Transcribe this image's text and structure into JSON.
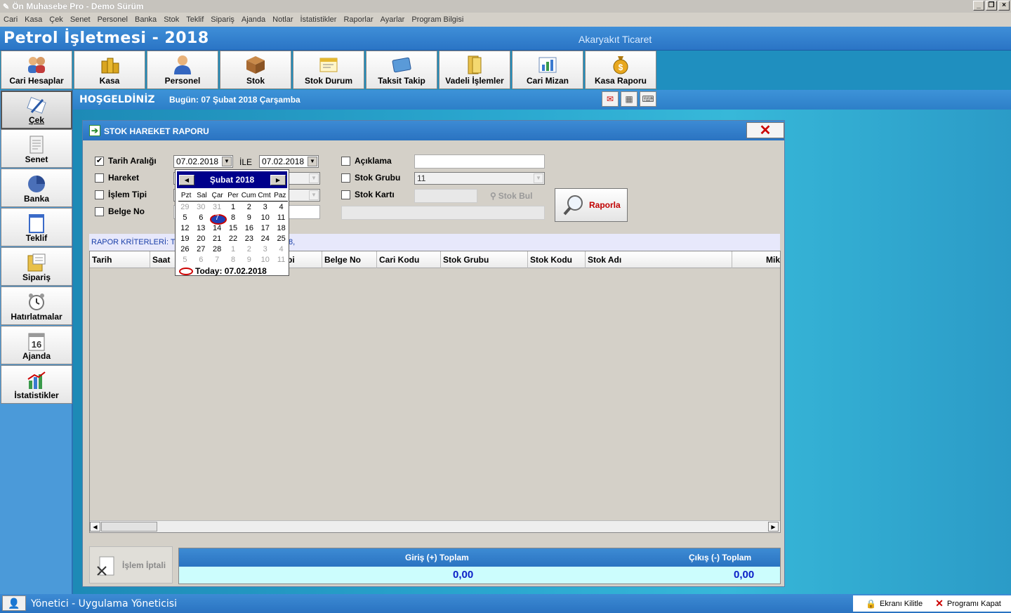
{
  "window": {
    "title": "Ön Muhasebe Pro - Demo Sürüm"
  },
  "menu": [
    "Cari",
    "Kasa",
    "Çek",
    "Senet",
    "Personel",
    "Banka",
    "Stok",
    "Teklif",
    "Sipariş",
    "Ajanda",
    "Notlar",
    "İstatistikler",
    "Raporlar",
    "Ayarlar",
    "Program Bilgisi"
  ],
  "header": {
    "company": "Petrol İşletmesi - 2018",
    "sector": "Akaryakıt Ticaret"
  },
  "toolbar": [
    {
      "label": "Cari Hesaplar",
      "icon": "users-icon"
    },
    {
      "label": "Kasa",
      "icon": "coins-icon"
    },
    {
      "label": "Personel",
      "icon": "person-icon"
    },
    {
      "label": "Stok",
      "icon": "box-icon"
    },
    {
      "label": "Stok Durum",
      "icon": "window-icon"
    },
    {
      "label": "Taksit Takip",
      "icon": "card-icon"
    },
    {
      "label": "Vadeli İşlemler",
      "icon": "folder-icon"
    },
    {
      "label": "Cari Mizan",
      "icon": "chart-icon"
    },
    {
      "label": "Kasa Raporu",
      "icon": "money-bag-icon"
    }
  ],
  "welcome": {
    "greeting": "HOŞGELDİNİZ",
    "today": "Bugün: 07 Şubat 2018 Çarşamba"
  },
  "sidebar": [
    {
      "label": "Çek",
      "icon": "pen-icon",
      "active": true
    },
    {
      "label": "Senet",
      "icon": "document-icon"
    },
    {
      "label": "Banka",
      "icon": "pie-icon"
    },
    {
      "label": "Teklif",
      "icon": "notepad-icon"
    },
    {
      "label": "Sipariş",
      "icon": "order-icon"
    },
    {
      "label": "Hatırlatmalar",
      "icon": "alarm-clock-icon"
    },
    {
      "label": "Ajanda",
      "icon": "calendar-icon"
    },
    {
      "label": "İstatistikler",
      "icon": "stats-icon"
    }
  ],
  "dialog": {
    "title": "STOK HAREKET RAPORU",
    "filters": {
      "tarih_araligi": {
        "label": "Tarih Aralığı",
        "checked": true,
        "from": "07.02.2018",
        "to": "07.02.2018",
        "sep": "İLE"
      },
      "hareket": {
        "label": "Hareket",
        "checked": false
      },
      "islem_tipi": {
        "label": "İşlem Tipi",
        "checked": false
      },
      "belge_no": {
        "label": "Belge No",
        "checked": false
      },
      "aciklama": {
        "label": "Açıklama",
        "checked": false
      },
      "stok_grubu": {
        "label": "Stok Grubu",
        "checked": false,
        "value": "11"
      },
      "stok_karti": {
        "label": "Stok Kartı",
        "checked": false
      },
      "stok_bul": "Stok Bul"
    },
    "rapor_button": "Raporla",
    "criteria_left": "RAPOR KRİTERLERİ:  T",
    "criteria_right": "8,",
    "columns": [
      "Tarih",
      "Saat",
      "pi",
      "Belge No",
      "Cari Kodu",
      "Stok Grubu",
      "Stok Kodu",
      "Stok Adı",
      "Mik"
    ],
    "iptal_button": "İşlem İptali",
    "totals": {
      "giris_label": "Giriş (+) Toplam",
      "cikis_label": "Çıkış (-) Toplam",
      "giris_value": "0,00",
      "cikis_value": "0,00"
    }
  },
  "calendar": {
    "title": "Şubat 2018",
    "dow": [
      "Pzt",
      "Sal",
      "Çar",
      "Per",
      "Cum",
      "Cmt",
      "Paz"
    ],
    "weeks": [
      [
        {
          "d": "29",
          "o": true
        },
        {
          "d": "30",
          "o": true
        },
        {
          "d": "31",
          "o": true
        },
        {
          "d": "1"
        },
        {
          "d": "2"
        },
        {
          "d": "3"
        },
        {
          "d": "4"
        }
      ],
      [
        {
          "d": "5"
        },
        {
          "d": "6"
        },
        {
          "d": "7",
          "t": true
        },
        {
          "d": "8"
        },
        {
          "d": "9"
        },
        {
          "d": "10"
        },
        {
          "d": "11"
        }
      ],
      [
        {
          "d": "12"
        },
        {
          "d": "13"
        },
        {
          "d": "14"
        },
        {
          "d": "15"
        },
        {
          "d": "16"
        },
        {
          "d": "17"
        },
        {
          "d": "18"
        }
      ],
      [
        {
          "d": "19"
        },
        {
          "d": "20"
        },
        {
          "d": "21"
        },
        {
          "d": "22"
        },
        {
          "d": "23"
        },
        {
          "d": "24"
        },
        {
          "d": "25"
        }
      ],
      [
        {
          "d": "26"
        },
        {
          "d": "27"
        },
        {
          "d": "28"
        },
        {
          "d": "1",
          "o": true
        },
        {
          "d": "2",
          "o": true
        },
        {
          "d": "3",
          "o": true
        },
        {
          "d": "4",
          "o": true
        }
      ],
      [
        {
          "d": "5",
          "o": true
        },
        {
          "d": "6",
          "o": true
        },
        {
          "d": "7",
          "o": true
        },
        {
          "d": "8",
          "o": true
        },
        {
          "d": "9",
          "o": true
        },
        {
          "d": "10",
          "o": true
        },
        {
          "d": "11",
          "o": true
        }
      ]
    ],
    "today_text": "Today: 07.02.2018"
  },
  "status": {
    "user": "Yönetici - Uygulama Yöneticisi",
    "lock": "Ekranı Kilitle",
    "close": "Programı Kapat"
  }
}
